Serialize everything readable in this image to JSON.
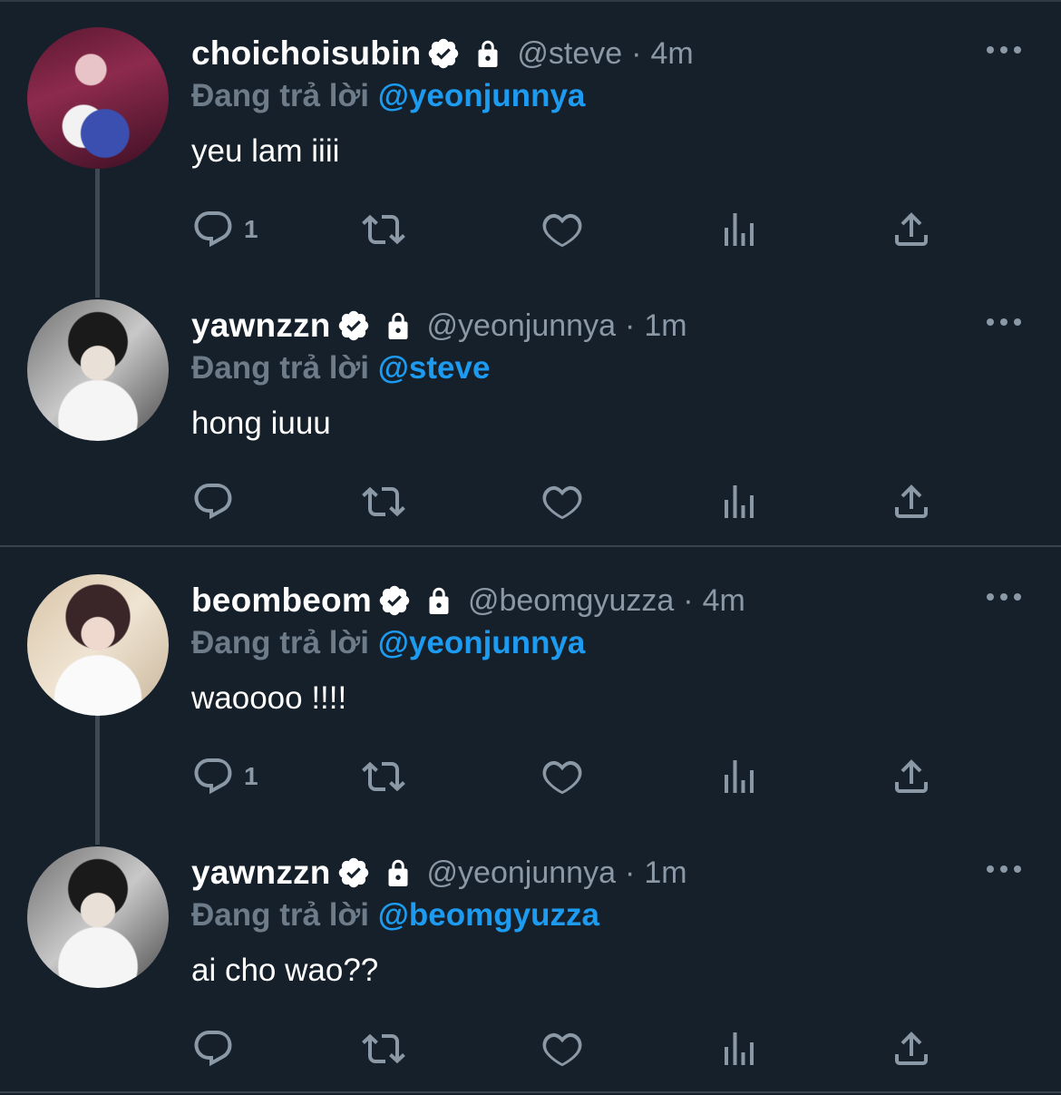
{
  "reply_prefix": "Đang trả lời",
  "colors": {
    "background": "#15202b",
    "secondary_text": "#8b98a5",
    "link": "#1d9bf0",
    "divider": "#38444d"
  },
  "tweets": [
    {
      "display_name": "choichoisubin",
      "handle": "@steve",
      "separator": "·",
      "time": "4m",
      "reply_to": "@yeonjunnya",
      "text": "yeu lam iiii",
      "reply_count": "1",
      "avatar": "avatar-steve"
    },
    {
      "display_name": "yawnzzn",
      "handle": "@yeonjunnya",
      "separator": "·",
      "time": "1m",
      "reply_to": "@steve",
      "text": "hong iuuu",
      "reply_count": "",
      "avatar": "avatar-yeonjunnya"
    },
    {
      "display_name": "beombeom",
      "handle": "@beomgyuzza",
      "separator": "·",
      "time": "4m",
      "reply_to": "@yeonjunnya",
      "text": "waoooo !!!!",
      "reply_count": "1",
      "avatar": "avatar-beomgyuzza"
    },
    {
      "display_name": "yawnzzn",
      "handle": "@yeonjunnya",
      "separator": "·",
      "time": "1m",
      "reply_to": "@beomgyuzza",
      "text": "ai cho wao??",
      "reply_count": "",
      "avatar": "avatar-yeonjunnya"
    }
  ],
  "icons": [
    "verified-badge-icon",
    "lock-icon",
    "more-icon",
    "reply-icon",
    "retweet-icon",
    "like-icon",
    "stats-icon",
    "share-icon"
  ]
}
